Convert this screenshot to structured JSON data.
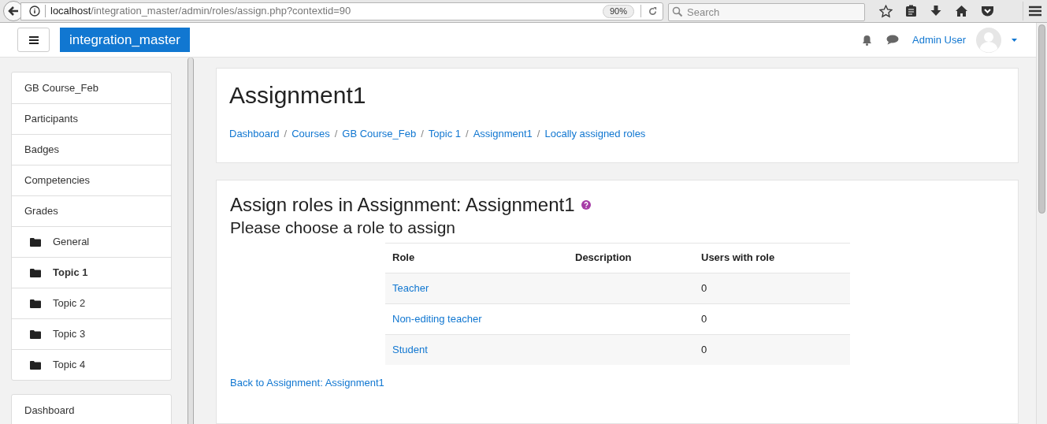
{
  "browser": {
    "url_host": "localhost",
    "url_path": "/integration_master/admin/roles/assign.php?contextid=90",
    "zoom": "90%",
    "search_placeholder": "Search"
  },
  "navbar": {
    "brand": "integration_master",
    "user": "Admin User"
  },
  "sidebar": {
    "groups": [
      {
        "items": [
          {
            "label": "GB Course_Feb",
            "kind": "link",
            "selected": false
          },
          {
            "label": "Participants",
            "kind": "link",
            "selected": false
          },
          {
            "label": "Badges",
            "kind": "link",
            "selected": false
          },
          {
            "label": "Competencies",
            "kind": "link",
            "selected": false
          },
          {
            "label": "Grades",
            "kind": "link",
            "selected": false
          },
          {
            "label": "General",
            "kind": "folder",
            "selected": false
          },
          {
            "label": "Topic 1",
            "kind": "folder",
            "selected": true
          },
          {
            "label": "Topic 2",
            "kind": "folder",
            "selected": false
          },
          {
            "label": "Topic 3",
            "kind": "folder",
            "selected": false
          },
          {
            "label": "Topic 4",
            "kind": "folder",
            "selected": false
          }
        ]
      },
      {
        "items": [
          {
            "label": "Dashboard",
            "kind": "link",
            "selected": false
          }
        ]
      }
    ]
  },
  "header": {
    "title": "Assignment1",
    "breadcrumb_separator": "/",
    "breadcrumbs": [
      "Dashboard",
      "Courses",
      "GB Course_Feb",
      "Topic 1",
      "Assignment1",
      "Locally assigned roles"
    ]
  },
  "content": {
    "heading": "Assign roles in Assignment: Assignment1",
    "subheading": "Please choose a role to assign",
    "table": {
      "columns": [
        "Role",
        "Description",
        "Users with role"
      ],
      "rows": [
        {
          "role": "Teacher",
          "users": "0"
        },
        {
          "role": "Non-editing teacher",
          "users": "0"
        },
        {
          "role": "Student",
          "users": "0"
        }
      ]
    },
    "back_link": "Back to Assignment: Assignment1"
  }
}
